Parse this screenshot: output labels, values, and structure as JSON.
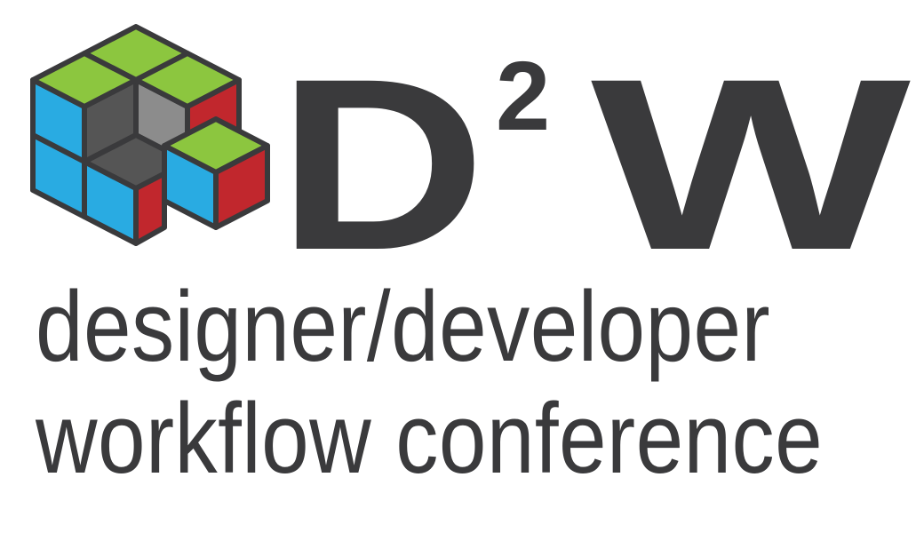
{
  "logo": {
    "icon_name": "stacked-cubes-logo-icon",
    "brand": {
      "letter_d": "D",
      "superscript": "2",
      "letter_w": "W"
    },
    "tagline": {
      "line1": "designer/developer",
      "line2": "workflow conference"
    },
    "colors": {
      "text": "#3a3a3c",
      "outline": "#3a3a3c",
      "green": "#8cc63f",
      "blue": "#29abe2",
      "red": "#c1272d",
      "dark_gray": "#555555",
      "light_gray": "#8c8c8c"
    }
  }
}
